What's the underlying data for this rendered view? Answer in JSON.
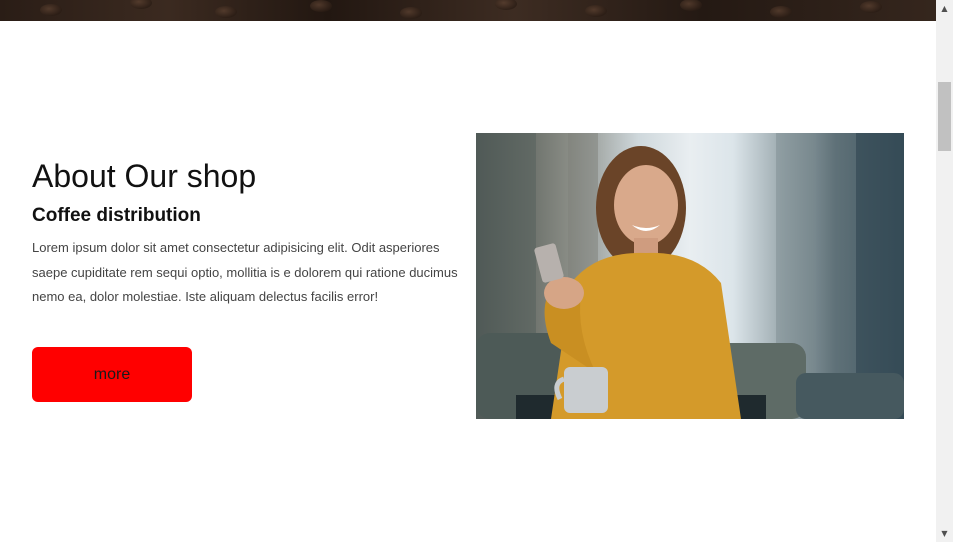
{
  "about": {
    "title": "About Our shop",
    "subtitle": "Coffee distribution",
    "body": "Lorem ipsum dolor sit amet consectetur adipisicing elit. Odit asperiores saepe cupiditate rem sequi optio, mollitia is e dolorem qui ratione ducimus nemo ea, dolor molestiae. Iste aliquam delectus facilis error!",
    "button_label": "more",
    "button_color": "#ff0000"
  },
  "scrollbar": {
    "up_icon": "triangle-up-icon",
    "down_icon": "triangle-down-icon"
  }
}
